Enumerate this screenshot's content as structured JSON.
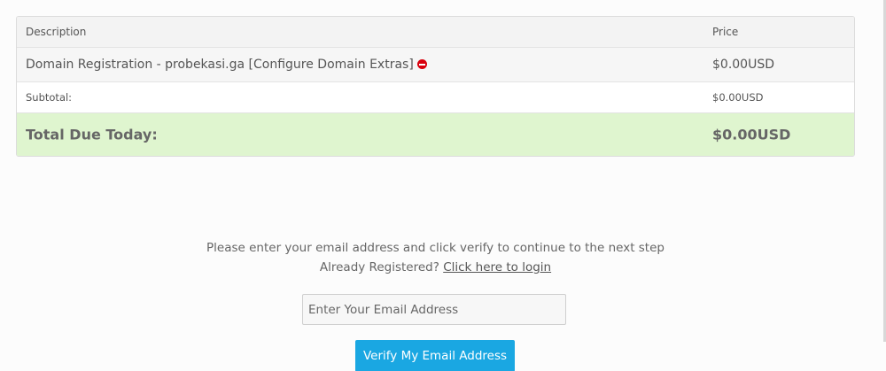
{
  "cart": {
    "header": {
      "description": "Description",
      "price": "Price"
    },
    "item": {
      "description": "Domain Registration - probekasi.ga [Configure Domain Extras]",
      "price": "$0.00USD",
      "remove_icon": "remove-circle-icon",
      "remove_icon_color": "#d9000d"
    },
    "subtotal": {
      "label": "Subtotal:",
      "value": "$0.00USD"
    },
    "total": {
      "label": "Total Due Today:",
      "value": "$0.00USD",
      "background": "#dff5cf"
    }
  },
  "verify": {
    "instruction": "Please enter your email address and click verify to continue to the next step",
    "already_registered": "Already Registered?",
    "login_link": "Click here to login",
    "email_placeholder": "Enter Your Email Address",
    "email_value": "",
    "button_label": "Verify My Email Address",
    "button_color": "#1aa7e2"
  }
}
